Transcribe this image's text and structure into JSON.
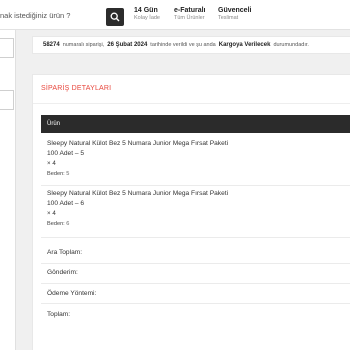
{
  "header": {
    "search_placeholder": "nak istediğiniz ürün ?",
    "features": [
      {
        "title": "14 Gün",
        "subtitle": "Kolay İade"
      },
      {
        "title": "e-Faturalı",
        "subtitle": "Tüm Ürünler"
      },
      {
        "title": "Güvenceli",
        "subtitle": "Teslimat"
      }
    ]
  },
  "order_info": {
    "order_number": "58274",
    "number_text": "numaralı siparişi,",
    "date": "26 Şubat 2024",
    "date_text": "tarihinde verildi ve şu anda",
    "status": "Kargoya Verilecek",
    "status_text": "durumundadır."
  },
  "details": {
    "title": "SİPARİŞ DETAYLARI",
    "table_header": "Ürün",
    "items": [
      {
        "name": "Sleepy Natural Külot Bez 5 Numara Junior Mega Fırsat Paketi 100 Adet – 5",
        "qty": "× 4",
        "size_label": "Beden:",
        "size_value": "5"
      },
      {
        "name": "Sleepy Natural Külot Bez 5 Numara Junior Mega Fırsat Paketi 100 Adet – 6",
        "qty": "× 4",
        "size_label": "Beden:",
        "size_value": "6"
      }
    ],
    "totals": {
      "subtotal_label": "Ara Toplam:",
      "shipping_label": "Gönderim:",
      "payment_label": "Ödeme Yöntemi:",
      "total_label": "Toplam:"
    }
  },
  "colors": {
    "accent": "#e8473d",
    "table_header_bg": "#2b2b2b"
  }
}
